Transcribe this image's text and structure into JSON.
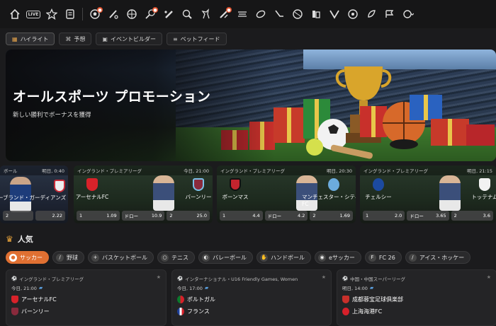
{
  "nav": {
    "icons": [
      "home-icon",
      "live-icon",
      "star-icon",
      "betslip-icon",
      "soccer-icon",
      "baseball-icon",
      "basketball-icon",
      "tennis-icon",
      "cricket-icon",
      "table-tennis-icon",
      "volleyball-icon",
      "handball-icon",
      "american-football-icon",
      "darts-icon",
      "ice-hockey-icon",
      "rugby-icon",
      "boxing-icon",
      "golf-icon",
      "snooker-icon",
      "esports-icon",
      "motorsport-icon",
      "cycling-icon",
      "more-sports-icon"
    ],
    "live_label": "LIVE"
  },
  "subtabs": [
    {
      "label": "ハイライト",
      "icon": "highlight-icon",
      "active": true
    },
    {
      "label": "予想",
      "icon": "prediction-icon",
      "active": false
    },
    {
      "label": "イベントビルダー",
      "icon": "event-builder-icon",
      "active": false
    },
    {
      "label": "ベットフィード",
      "icon": "bet-feed-icon",
      "active": false
    }
  ],
  "banner": {
    "title": "オールスポーツ プロモーション",
    "subtitle": "新しい勝利でボーナスを獲得"
  },
  "matches": [
    {
      "league": "ボール",
      "time": "明日, 0:40",
      "home": "クリーブランド・ガーディアンズ",
      "away": "",
      "odds": [
        {
          "k": "2",
          "v": ""
        },
        {
          "k": "",
          "v": "2.22"
        }
      ]
    },
    {
      "league": "イングランド・プレミアリーグ",
      "time": "今日, 21:00",
      "home": "アーセナルFC",
      "away": "バーンリー",
      "odds": [
        {
          "k": "1",
          "v": "1.09"
        },
        {
          "k": "ドロー",
          "v": "10.9"
        },
        {
          "k": "2",
          "v": "25.0"
        }
      ]
    },
    {
      "league": "イングランド・プレミアリーグ",
      "time": "明日, 20:30",
      "home": "ボーンマス",
      "away": "マンチェスター・シティFC",
      "odds": [
        {
          "k": "1",
          "v": "4.4"
        },
        {
          "k": "ドロー",
          "v": "4.2"
        },
        {
          "k": "2",
          "v": "1.69"
        }
      ]
    },
    {
      "league": "イングランド・プレミアリーグ",
      "time": "明日, 21:15",
      "home": "チェルシー",
      "away": "トッテナム",
      "odds": [
        {
          "k": "1",
          "v": "2.0"
        },
        {
          "k": "ドロー",
          "v": "3.65"
        },
        {
          "k": "2",
          "v": "3.6"
        }
      ]
    }
  ],
  "popular": {
    "title": "人気"
  },
  "sports": [
    {
      "label": "サッカー",
      "active": true
    },
    {
      "label": "野球",
      "active": false
    },
    {
      "label": "バスケットボール",
      "active": false
    },
    {
      "label": "テニス",
      "active": false
    },
    {
      "label": "バレーボール",
      "active": false
    },
    {
      "label": "ハンドボール",
      "active": false
    },
    {
      "label": "eサッカー",
      "active": false
    },
    {
      "label": "FC 26",
      "active": false
    },
    {
      "label": "アイス・ホッケー",
      "active": false
    }
  ],
  "list": [
    {
      "league": "イングランド・プレミアリーグ",
      "time": "今日, 21:00",
      "home": "アーセナルFC",
      "away": "バーンリー"
    },
    {
      "league": "インターナショナル・U16 Friendly Games, Women",
      "time": "今日, 17:00",
      "home": "ポルトガル",
      "away": "フランス"
    },
    {
      "league": "中国・中国スーパーリーグ",
      "time": "明日, 14:00",
      "home": "成都蓉宝足球俱楽部",
      "away": "上海海港FC"
    }
  ]
}
